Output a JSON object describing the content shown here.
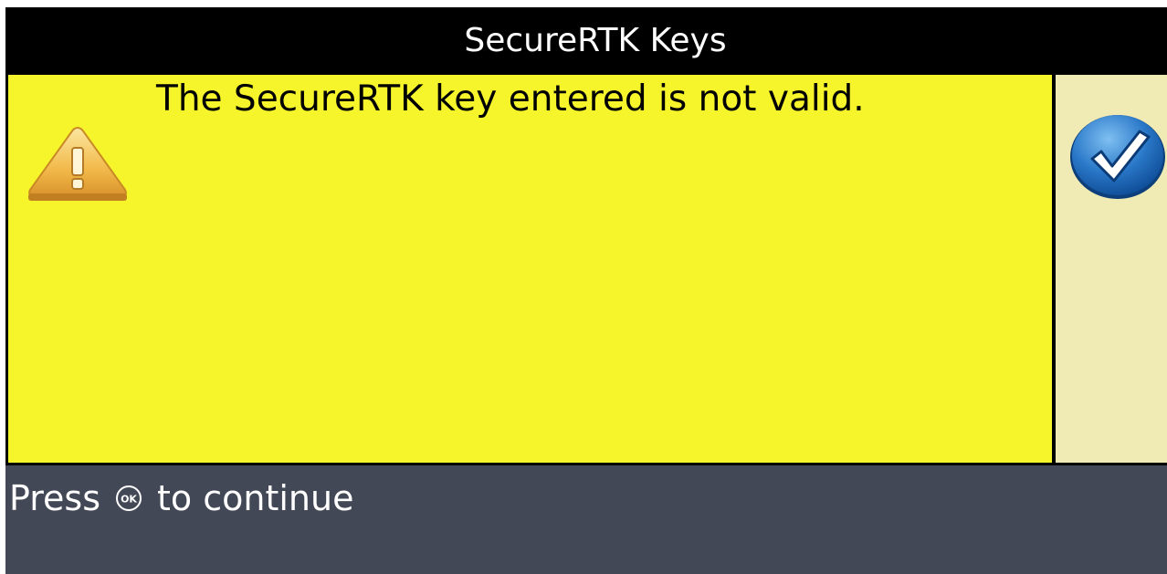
{
  "title": "SecureRTK Keys",
  "message": "The SecureRTK key entered is not valid.",
  "footer": {
    "prefix": "Press",
    "key_label": "OK",
    "suffix": "to continue"
  },
  "icons": {
    "warning": "warning-triangle-icon",
    "confirm": "checkmark-icon"
  },
  "colors": {
    "title_bg": "#000000",
    "message_bg": "#f6f52b",
    "side_bg": "#f0ebb5",
    "footer_bg": "#434856",
    "confirm_button": "#1b63b8"
  }
}
